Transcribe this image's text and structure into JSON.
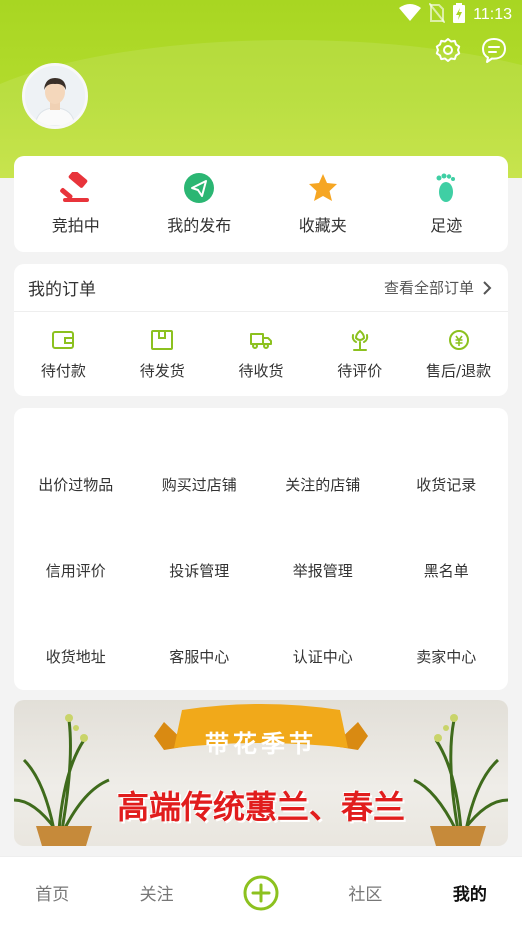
{
  "status_bar": {
    "time": "11:13",
    "icons": [
      "wifi-icon",
      "no-sim-icon",
      "battery-charging-icon"
    ]
  },
  "header": {
    "icons": [
      "settings-icon",
      "message-icon"
    ],
    "avatar": "user-avatar"
  },
  "quick_actions": [
    {
      "label": "竞拍中",
      "icon": "auction-hammer-icon",
      "color": "#e8343b"
    },
    {
      "label": "我的发布",
      "icon": "paper-plane-icon",
      "color": "#2bb673"
    },
    {
      "label": "收藏夹",
      "icon": "star-icon",
      "color": "#f6a623"
    },
    {
      "label": "足迹",
      "icon": "footprint-icon",
      "color": "#3fcfa4"
    }
  ],
  "orders": {
    "title": "我的订单",
    "view_all": "查看全部订单",
    "items": [
      {
        "label": "待付款",
        "icon": "wallet-icon"
      },
      {
        "label": "待发货",
        "icon": "package-icon"
      },
      {
        "label": "待收货",
        "icon": "truck-icon"
      },
      {
        "label": "待评价",
        "icon": "flower-review-icon"
      },
      {
        "label": "售后/退款",
        "icon": "refund-icon"
      }
    ],
    "icon_color": "#8cc11f"
  },
  "services": [
    [
      "出价过物品",
      "购买过店铺",
      "关注的店铺",
      "收货记录"
    ],
    [
      "信用评价",
      "投诉管理",
      "举报管理",
      "黑名单"
    ],
    [
      "收货地址",
      "客服中心",
      "认证中心",
      "卖家中心"
    ]
  ],
  "banner": {
    "ribbon": "带花季节",
    "headline": "高端传统蕙兰、春兰"
  },
  "tabbar": {
    "tabs": [
      "首页",
      "关注",
      "社区",
      "我的"
    ],
    "active": "我的",
    "center_icon": "plus-circle-icon",
    "accent": "#8cc11f"
  }
}
